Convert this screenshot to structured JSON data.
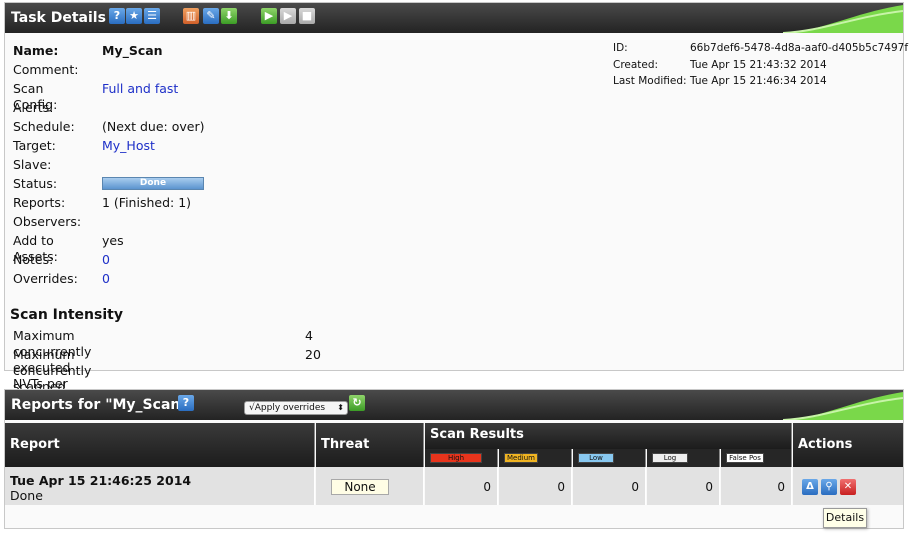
{
  "task_panel": {
    "title": "Task Details",
    "fields": [
      {
        "label": "Name:",
        "value": "My_Scan",
        "kind": "bold"
      },
      {
        "label": "Comment:",
        "value": "",
        "kind": "text"
      },
      {
        "label": "Scan Config:",
        "value": "Full and fast",
        "kind": "link"
      },
      {
        "label": "Alerts:",
        "value": "",
        "kind": "text"
      },
      {
        "label": "Schedule:",
        "value": "(Next due: over)",
        "kind": "text"
      },
      {
        "label": "Target:",
        "value": "My_Host",
        "kind": "link"
      },
      {
        "label": "Slave:",
        "value": "",
        "kind": "text"
      },
      {
        "label": "Status:",
        "value": "Done",
        "kind": "status"
      },
      {
        "label": "Reports:",
        "value": "1 (Finished: 1)",
        "kind": "text"
      },
      {
        "label": "Observers:",
        "value": "",
        "kind": "text"
      },
      {
        "label": "Add to Assets:",
        "value": "yes",
        "kind": "text"
      },
      {
        "label": "Notes:",
        "value": "0",
        "kind": "link"
      },
      {
        "label": "Overrides:",
        "value": "0",
        "kind": "link"
      }
    ],
    "meta": {
      "id_label": "ID:",
      "id_value": "66b7def6-5478-4d8a-aaf0-d405b5c7497f",
      "created_label": "Created:",
      "created_value": "Tue Apr 15 21:43:32 2014",
      "modified_label": "Last Modified:",
      "modified_value": "Tue Apr 15 21:46:34 2014"
    },
    "scan_intensity": {
      "title": "Scan Intensity",
      "nvts_label": "Maximum concurrently executed NVTs per host:",
      "nvts_value": "4",
      "hosts_label": "Maximum concurrently scanned hosts:",
      "hosts_value": "20"
    },
    "toolbar_icons": [
      "help-icon",
      "new-task-icon",
      "list-icon",
      "delete-icon",
      "edit-icon",
      "export-icon",
      "start-icon",
      "resume-icon",
      "stop-icon"
    ]
  },
  "reports_panel": {
    "title": "Reports for \"My_Scan\"",
    "overrides_select": "√Apply overrides",
    "columns": {
      "report": "Report",
      "threat": "Threat",
      "scan_results": "Scan Results",
      "actions": "Actions"
    },
    "severities": [
      {
        "label": "High",
        "color": "#e8341c"
      },
      {
        "label": "Medium",
        "color": "#f0b422"
      },
      {
        "label": "Low",
        "color": "#88c8f0"
      },
      {
        "label": "Log",
        "color": "#eeeeee"
      },
      {
        "label": "False Pos",
        "color": "#ffffff"
      }
    ],
    "row": {
      "date": "Tue Apr 15 21:46:25 2014",
      "status": "Done",
      "threat": "None",
      "counts": [
        "0",
        "0",
        "0",
        "0",
        "0"
      ]
    },
    "tooltip": "Details"
  }
}
